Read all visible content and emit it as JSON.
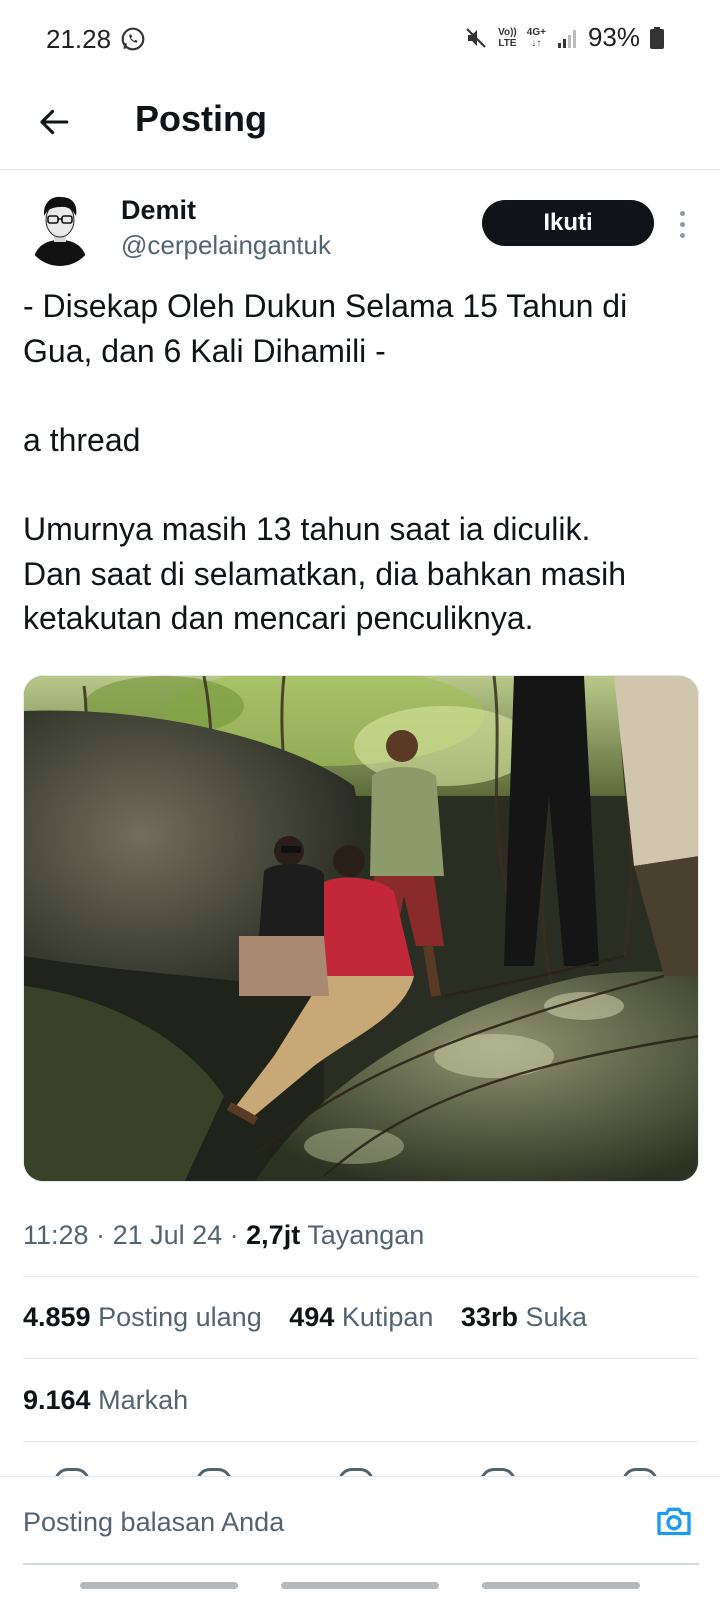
{
  "status_bar": {
    "time": "21.28",
    "volte_line1": "Vo))",
    "volte_line2": "LTE",
    "net_line1": "4G+",
    "net_line2": "↓↑",
    "battery": "93%"
  },
  "header": {
    "title": "Posting"
  },
  "author": {
    "name": "Demit",
    "handle": "@cerpelaingantuk",
    "follow_label": "Ikuti"
  },
  "tweet": {
    "line1": "- Disekap Oleh Dukun Selama 15 Tahun di",
    "line2": "Gua, dan 6 Kali Dihamili -",
    "line3": "a thread",
    "line4": "Umurnya masih 13 tahun saat ia diculik.",
    "line5": "Dan saat di selamatkan, dia bahkan masih",
    "line6": "ketakutan dan mencari penculiknya."
  },
  "meta": {
    "time": "11:28",
    "date": "21 Jul 24",
    "views_count": "2,7jt",
    "views_label": "Tayangan"
  },
  "stats": {
    "reposts_count": "4.859",
    "reposts_label": "Posting ulang",
    "quotes_count": "494",
    "quotes_label": "Kutipan",
    "likes_count": "33rb",
    "likes_label": "Suka",
    "bookmarks_count": "9.164",
    "bookmarks_label": "Markah"
  },
  "reply": {
    "placeholder": "Posting balasan Anda"
  },
  "colors": {
    "text_primary": "#0f1419",
    "text_secondary": "#536471",
    "divider": "#e6e9ec",
    "accent": "#1d9bf0",
    "follow_bg": "#0f1419"
  },
  "icons": {
    "back": "arrow-left-icon",
    "more": "more-vertical-icon",
    "camera": "camera-icon",
    "whatsapp": "whatsapp-icon",
    "mute": "mute-icon",
    "signal": "signal-icon",
    "battery": "battery-icon"
  }
}
